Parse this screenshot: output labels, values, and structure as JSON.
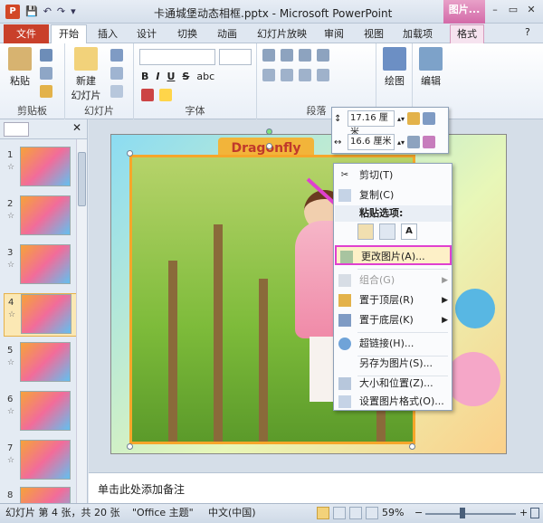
{
  "window": {
    "title": "卡通城堡动态相框.pptx - Microsoft PowerPoint",
    "app_logo": "P",
    "context_tab_group": "图片...",
    "win_minimize": "–",
    "win_restore": "▭",
    "win_close": "✕"
  },
  "quick_access": {
    "save": "💾",
    "undo": "↶",
    "redo": "↷",
    "customize": "▾"
  },
  "tabs": {
    "file": "文件",
    "home": "开始",
    "insert": "插入",
    "design": "设计",
    "transitions": "切换",
    "animations": "动画",
    "slideshow": "幻灯片放映",
    "review": "审阅",
    "view": "视图",
    "addins": "加载项",
    "format": "格式",
    "help": "?"
  },
  "ribbon": {
    "clipboard": {
      "label": "剪贴板",
      "paste": "粘贴"
    },
    "slides": {
      "label": "幻灯片",
      "new_slide": "新建",
      "new_slide2": "幻灯片"
    },
    "font": {
      "label": "字体",
      "bold": "B",
      "italic": "I",
      "underline": "U",
      "strike": "S",
      "shadow": "abc"
    },
    "paragraph": {
      "label": "段落"
    },
    "drawing": {
      "label": "绘图"
    },
    "editing": {
      "label": "编辑"
    }
  },
  "size_popup": {
    "height": "17.16 厘米",
    "width": "16.6 厘米"
  },
  "slides_panel": {
    "slides": [
      {
        "num": "1"
      },
      {
        "num": "2"
      },
      {
        "num": "3"
      },
      {
        "num": "4"
      },
      {
        "num": "5"
      },
      {
        "num": "6"
      },
      {
        "num": "7"
      },
      {
        "num": "8"
      }
    ],
    "star": "☆",
    "selected_index": 4
  },
  "slide": {
    "banner_text": "Dragonfly"
  },
  "context_menu": {
    "cut": "剪切(T)",
    "copy": "复制(C)",
    "paste_options": "粘贴选项:",
    "paste_keep_text": "A",
    "change_picture": "更改图片(A)...",
    "group": "组合(G)",
    "bring_front": "置于顶层(R)",
    "send_back": "置于底层(K)",
    "hyperlink": "超链接(H)...",
    "save_as_picture": "另存为图片(S)...",
    "size_position": "大小和位置(Z)...",
    "format_picture": "设置图片格式(O)..."
  },
  "notes": {
    "placeholder": "单击此处添加备注"
  },
  "status": {
    "slide_info": "幻灯片 第 4 张，共 20 张",
    "theme": "\"Office 主题\"",
    "language": "中文(中国)",
    "zoom": "59%",
    "zoom_minus": "−",
    "zoom_plus": "+"
  },
  "colors": {
    "file_tab": "#c9402a",
    "highlight_border": "#e040d0",
    "highlight_bg": "#fdf0c7"
  }
}
